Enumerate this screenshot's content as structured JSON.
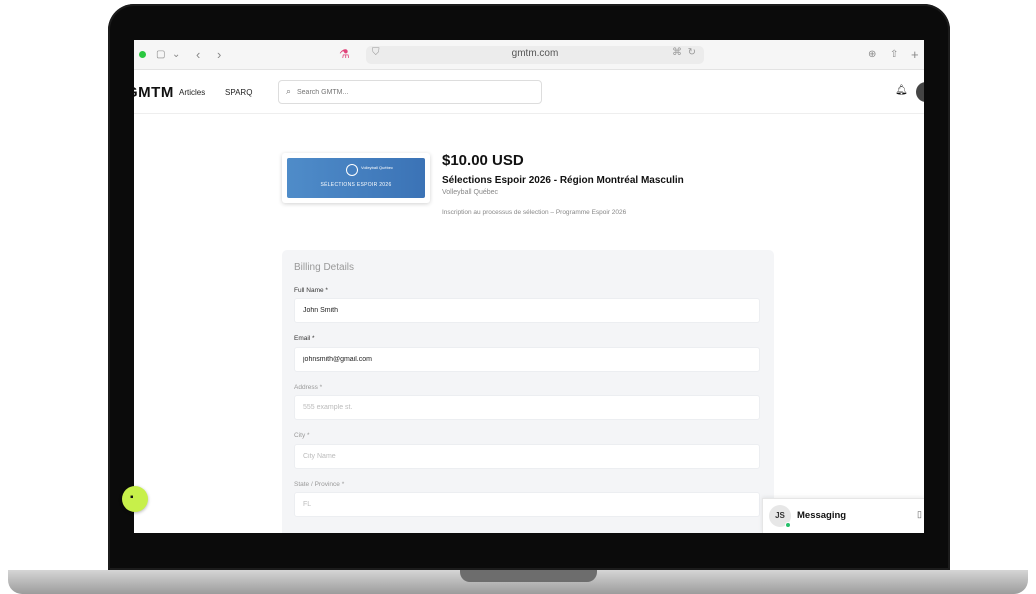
{
  "browser": {
    "url": "gmtm.com",
    "icons": [
      "sidebar-icon",
      "chevron-down-icon",
      "back-icon",
      "forward-icon",
      "lab-flask-icon",
      "lock-icon",
      "translate-icon",
      "reload-icon",
      "download-icon",
      "share-icon",
      "new-tab-icon"
    ]
  },
  "nav": {
    "logo": "GMTM",
    "links": [
      "Articles",
      "SPARQ"
    ],
    "search_placeholder": "Search GMTM..."
  },
  "product": {
    "image_text": "SÉLECTIONS ESPOIR 2026",
    "image_org": "Volleyball Québec",
    "price": "$10.00 USD",
    "title": "Sélections Espoir 2026 - Région Montréal Masculin",
    "org": "Volleyball Québec",
    "description": "Inscription au processus de sélection – Programme Espoir 2026"
  },
  "billing": {
    "heading": "Billing Details",
    "fields": [
      {
        "label": "Full Name *",
        "value": "John Smith",
        "placeholder": ""
      },
      {
        "label": "Email *",
        "value": "johnsmith@gmail.com",
        "placeholder": ""
      },
      {
        "label": "Address *",
        "value": "",
        "placeholder": "555 example st."
      },
      {
        "label": "City *",
        "value": "",
        "placeholder": "City Name"
      },
      {
        "label": "State / Province *",
        "value": "",
        "placeholder": "FL"
      }
    ]
  },
  "messaging": {
    "initials": "JS",
    "label": "Messaging"
  },
  "colors": {
    "accent_green": "#c7f04a",
    "online_green": "#26c06b",
    "banner_blue": "#3b73b6"
  }
}
